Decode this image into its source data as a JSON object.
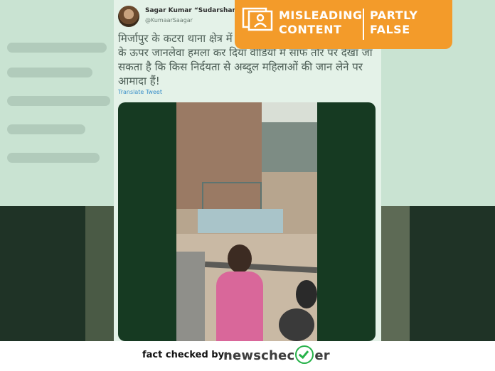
{
  "tweet": {
    "author_name": "Sagar Kumar “Sudarshan N",
    "author_handle": "@KumaarSaagar",
    "text": "मिर्जापुर के कटरा थाना क्षेत्र में करने पर हिंदू परिवार की महिलाओं के ऊपर जानलेवा हमला कर दिया वीडियो में साफ तौर पर देखा जा सकता है कि किस निर्दयता से अब्दुल महिलाओं की जान लेने पर आमादा हैं!",
    "translate_label": "Translate Tweet"
  },
  "verdict": {
    "label_left_line1": "MISLEADING",
    "label_left_line2": "CONTENT",
    "label_right_line1": "PARTLY",
    "label_right_line2": "FALSE",
    "icon": "person-card-icon",
    "color": "#f39b2a"
  },
  "footer": {
    "fact_checked_by": "fact checked by:",
    "brand_part1": "newschec",
    "brand_part2": "er",
    "brand_icon": "checkmark-circle-icon",
    "brand_color": "#27b24a"
  }
}
